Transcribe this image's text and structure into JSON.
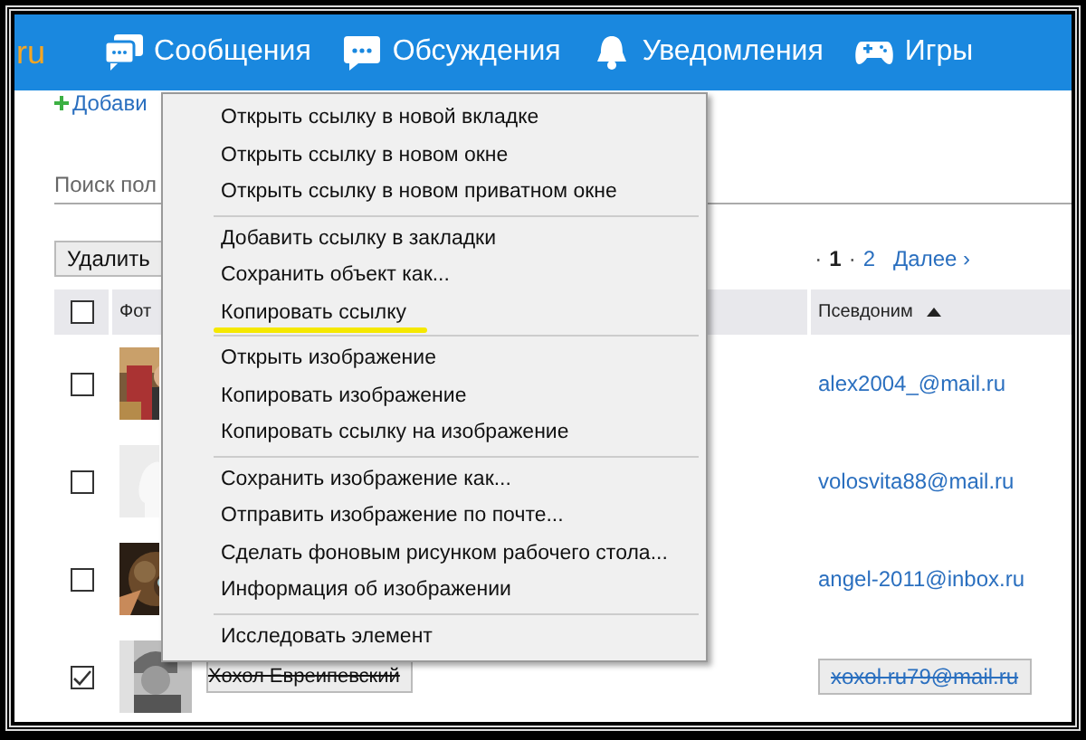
{
  "header": {
    "logo": "ru",
    "nav": [
      {
        "label": "Сообщения",
        "kind": "messages"
      },
      {
        "label": "Обсуждения",
        "kind": "discussions"
      },
      {
        "label": "Уведомления",
        "kind": "notifications"
      },
      {
        "label": "Игры",
        "kind": "games"
      }
    ]
  },
  "add_link": "Добави",
  "search": {
    "placeholder": "Поиск пол"
  },
  "toolbar": {
    "delete_button": "Удалить",
    "pagination": {
      "separator": "·",
      "pages": [
        {
          "label": "1",
          "selected": true
        },
        {
          "label": "2",
          "selected": false
        }
      ],
      "next": "Далее ›"
    }
  },
  "table": {
    "columns": [
      {
        "label": "Фот"
      },
      {
        "label": "Псевдоним",
        "sorted": true
      }
    ],
    "header_checked": false,
    "rows": [
      {
        "checked": false,
        "email": "alex2004_@mail.ru",
        "deleted": false
      },
      {
        "checked": false,
        "photo": {
          "kind": "silhouette"
        },
        "email": "volosvita88@mail.ru",
        "deleted": false
      },
      {
        "checked": false,
        "email": "angel-2011@inbox.ru",
        "deleted": false
      },
      {
        "checked": true,
        "name": "Хохол Евреипевский",
        "email": "xoxol.ru79@mail.ru",
        "deleted": true
      }
    ]
  },
  "context_menu": {
    "groups": [
      [
        {
          "label": "Открыть ссылку в новой вкладке",
          "highlighted": false
        },
        {
          "label": "Открыть ссылку в новом окне",
          "highlighted": false
        },
        {
          "label": "Открыть ссылку в новом приватном окне",
          "highlighted": false
        }
      ],
      [
        {
          "label": "Добавить ссылку в закладки",
          "highlighted": false
        },
        {
          "label": "Сохранить объект как...",
          "highlighted": false
        },
        {
          "label": "Копировать ссылку",
          "highlighted": true
        }
      ],
      [
        {
          "label": "Открыть изображение",
          "highlighted": false
        },
        {
          "label": "Копировать изображение",
          "highlighted": false
        },
        {
          "label": "Копировать ссылку на изображение",
          "highlighted": false
        }
      ],
      [
        {
          "label": "Сохранить изображение как...",
          "highlighted": false
        },
        {
          "label": "Отправить изображение по почте...",
          "highlighted": false
        },
        {
          "label": "Сделать фоновым рисунком рабочего стола...",
          "highlighted": false
        },
        {
          "label": "Информация об изображении",
          "highlighted": false
        }
      ],
      [
        {
          "label": "Исследовать элемент",
          "highlighted": false
        }
      ]
    ]
  }
}
